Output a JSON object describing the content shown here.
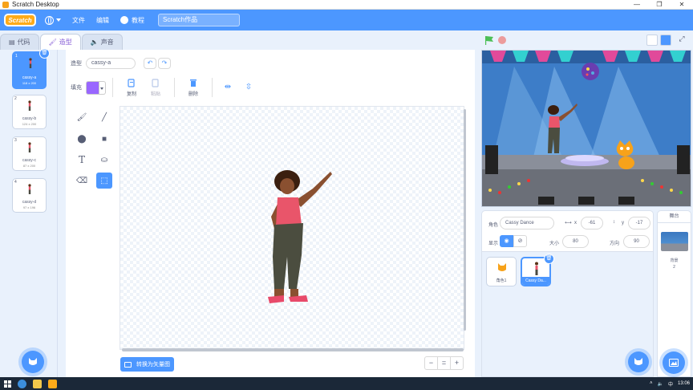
{
  "window": {
    "title": "Scratch Desktop",
    "controls": [
      "—",
      "❐",
      "✕"
    ]
  },
  "menubar": {
    "logo": "Scratch",
    "items": {
      "file": "文件",
      "edit": "编辑",
      "tutorials": "教程"
    },
    "project_title": "Scratch作品"
  },
  "tabs": {
    "code": "代码",
    "costumes": "造型",
    "sounds": "声音"
  },
  "costumes": [
    {
      "num": "1",
      "name": "cassy-a",
      "size": "118 x 200"
    },
    {
      "num": "2",
      "name": "cassy-b",
      "size": "124 x 200"
    },
    {
      "num": "3",
      "name": "cassy-c",
      "size": "87 x 200"
    },
    {
      "num": "4",
      "name": "cassy-d",
      "size": "97 x 196"
    }
  ],
  "editor": {
    "costume_label": "造型",
    "costume_name": "cassy-a",
    "fill_label": "填充",
    "fill_color": "#9966ff",
    "copy_label": "复制",
    "paste_label": "粘贴",
    "delete_label": "删除",
    "convert_label": "转换为矢量图",
    "zoom": {
      "out": "−",
      "reset": "=",
      "in": "+"
    }
  },
  "sprite_info": {
    "sprite_label": "角色",
    "sprite_name": "Cassy Dance",
    "x_label": "x",
    "x_value": "-61",
    "y_label": "y",
    "y_value": "-17",
    "show_label": "显示",
    "size_label": "大小",
    "size_value": "80",
    "direction_label": "方向",
    "direction_value": "90"
  },
  "sprites": [
    {
      "name": "角色1"
    },
    {
      "name": "Cassy Da..."
    }
  ],
  "stage_pane": {
    "title": "舞台",
    "backdrop_label": "背景",
    "backdrop_count": "2"
  },
  "taskbar": {
    "time": "13:06",
    "lang": "中"
  },
  "colors": {
    "accent": "#4c97ff",
    "menubar": "#4c97ff",
    "logo": "#ffab19"
  }
}
